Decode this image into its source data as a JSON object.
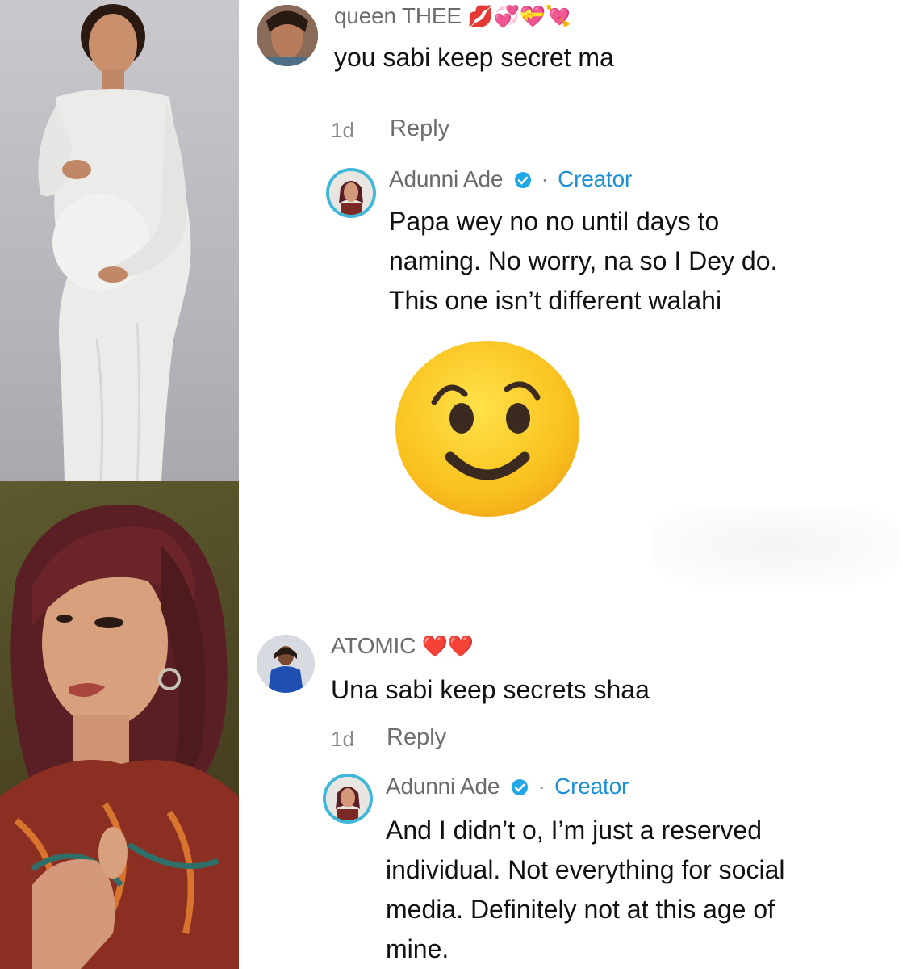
{
  "comments": [
    {
      "username": "queen THEE",
      "badges": "💋💞💝💘",
      "text": "you sabi keep secret ma",
      "age": "1d",
      "reply_label": "Reply",
      "reply": {
        "username": "Adunni Ade",
        "role": "Creator",
        "separator": "·",
        "lines": [
          "Papa wey no no until days to",
          "naming. No worry, na so I Dey do.",
          "This one isn’t different walahi"
        ],
        "emoji_icon": "smiling-face-emoji"
      }
    },
    {
      "username": "ATOMIC",
      "badges": "❤️❤️",
      "text": "Una sabi keep secrets shaa",
      "age": "1d",
      "reply_label": "Reply",
      "reply": {
        "username": "Adunni Ade",
        "role": "Creator",
        "separator": "·",
        "lines": [
          "And I didn’t o, I’m just a reserved",
          "individual. Not everything for social",
          "media. Definitely not at this age of",
          "mine."
        ]
      }
    }
  ],
  "colors": {
    "creator": "#1a8fd6",
    "avatar_ring": "#3fb7d8",
    "muted": "#8a8a8a"
  }
}
